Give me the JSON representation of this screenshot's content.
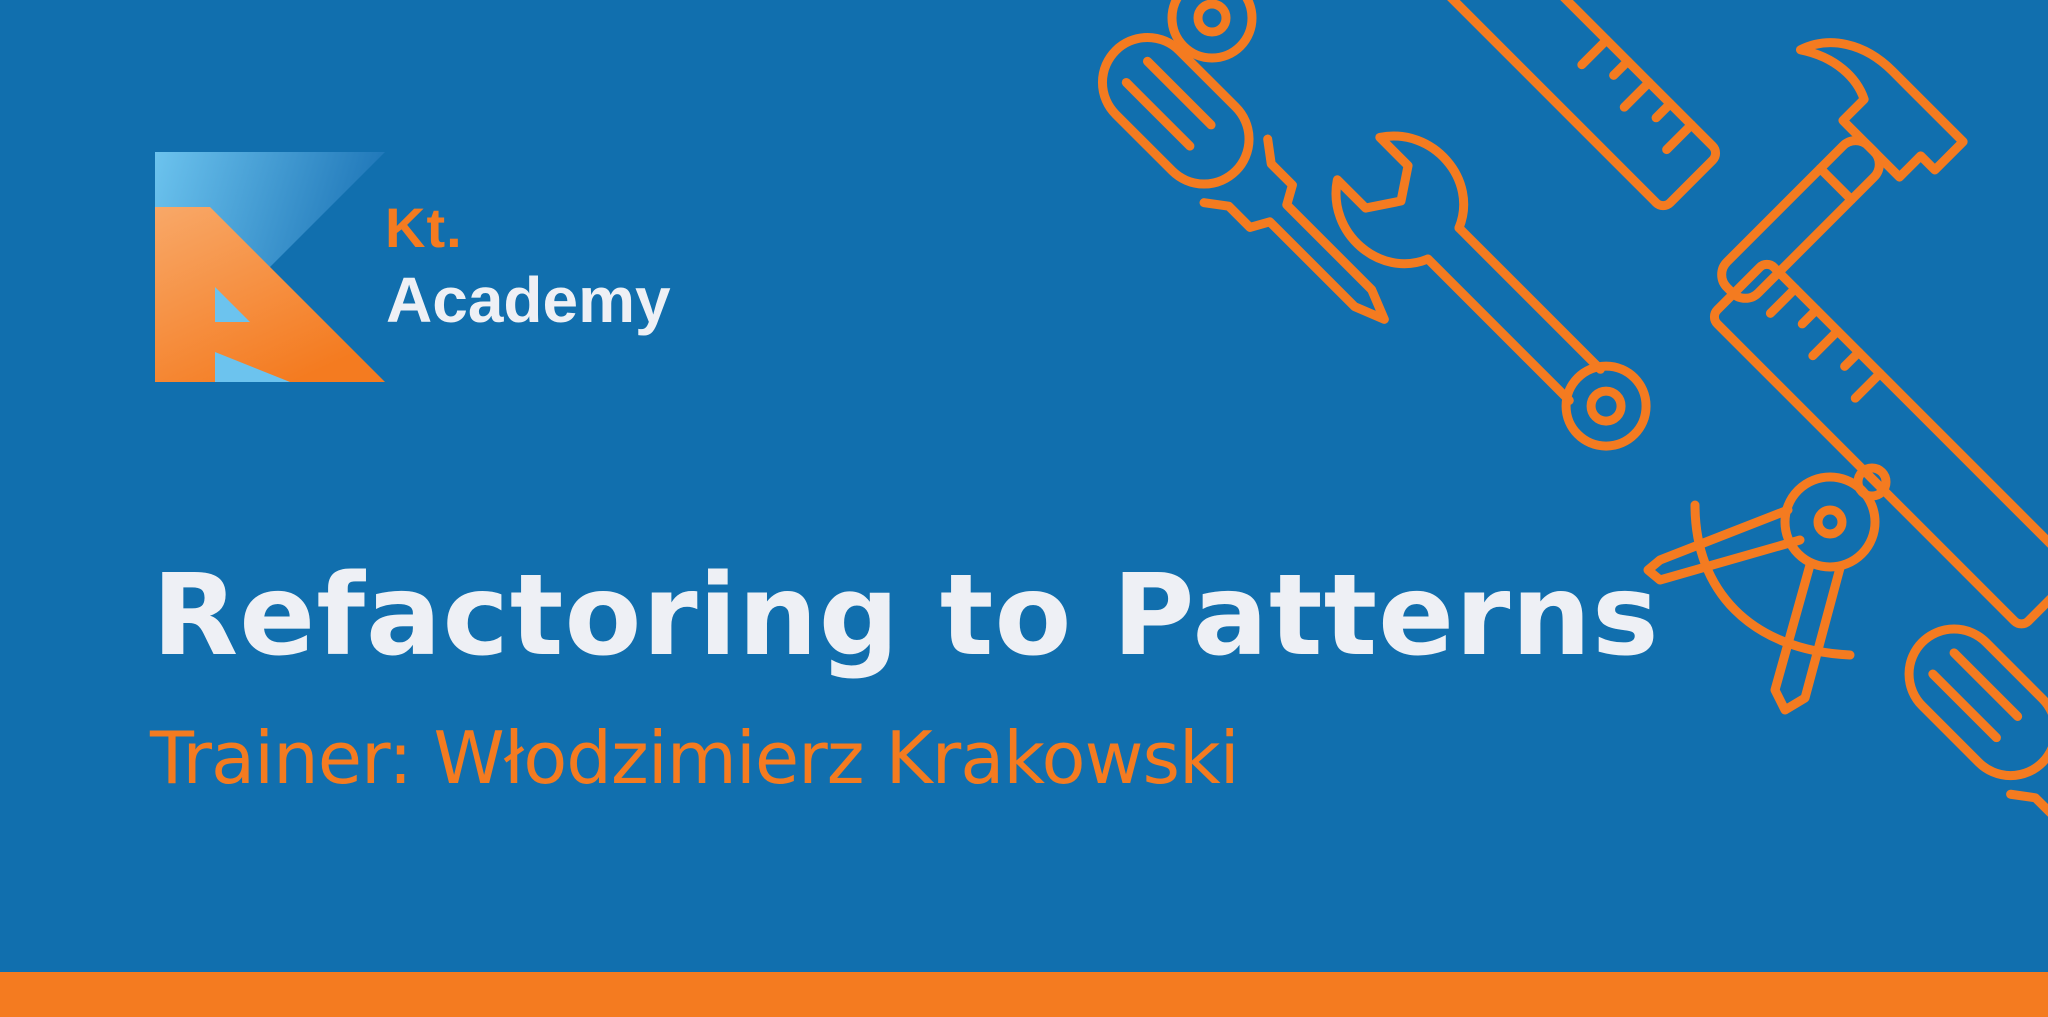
{
  "brand": {
    "line1": "Kt.",
    "line2": "Academy"
  },
  "title": "Refactoring to Patterns",
  "subtitle": "Trainer: Włodzimierz Krakowski",
  "colors": {
    "background": "#116fae",
    "accent": "#f47b20",
    "text": "#eef0f5"
  },
  "icons": [
    "ring-icon",
    "screwdriver-icon",
    "ruler-icon",
    "hammer-icon",
    "wrench-icon",
    "compass-icon",
    "utility-knife-icon"
  ]
}
